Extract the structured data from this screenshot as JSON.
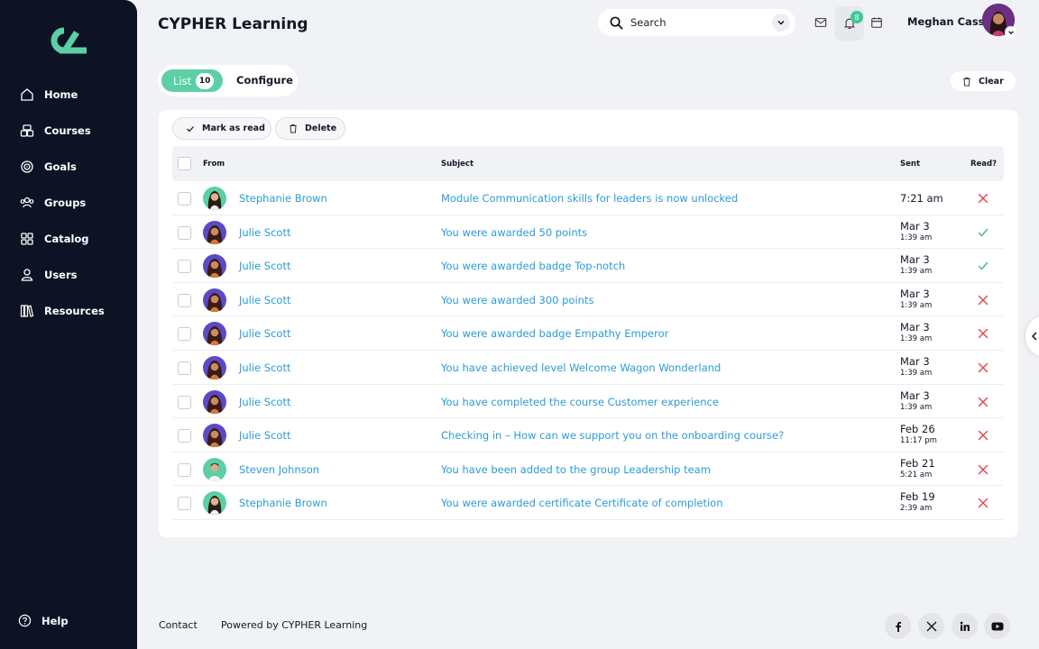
{
  "app": {
    "title": "CYPHER Learning"
  },
  "sidebar": {
    "items": [
      {
        "label": "Home",
        "icon": "home-icon"
      },
      {
        "label": "Courses",
        "icon": "courses-icon"
      },
      {
        "label": "Goals",
        "icon": "goals-icon"
      },
      {
        "label": "Groups",
        "icon": "groups-icon"
      },
      {
        "label": "Catalog",
        "icon": "catalog-icon"
      },
      {
        "label": "Users",
        "icon": "users-icon"
      },
      {
        "label": "Resources",
        "icon": "resources-icon"
      }
    ],
    "help_label": "Help"
  },
  "header": {
    "search_placeholder": "Search",
    "notification_count": "8",
    "user_name": "Meghan Cass"
  },
  "tabs": {
    "list_label": "List",
    "list_count": "10",
    "configure_label": "Configure"
  },
  "toolbar": {
    "clear_label": "Clear",
    "mark_read_label": "Mark as read",
    "delete_label": "Delete"
  },
  "table": {
    "headers": {
      "from": "From",
      "subject": "Subject",
      "sent": "Sent",
      "read": "Read?"
    },
    "rows": [
      {
        "from": "Stephanie Brown",
        "subject": "Module Communication skills for leaders is now unlocked",
        "date": "7:21 am",
        "time": "",
        "read": false,
        "avatar": "stephanie"
      },
      {
        "from": "Julie Scott",
        "subject": "You were awarded 50 points",
        "date": "Mar 3",
        "time": "1:39 am",
        "read": true,
        "avatar": "julie"
      },
      {
        "from": "Julie Scott",
        "subject": "You were awarded badge Top-notch",
        "date": "Mar 3",
        "time": "1:39 am",
        "read": true,
        "avatar": "julie"
      },
      {
        "from": "Julie Scott",
        "subject": "You were awarded 300 points",
        "date": "Mar 3",
        "time": "1:39 am",
        "read": false,
        "avatar": "julie"
      },
      {
        "from": "Julie Scott",
        "subject": "You were awarded badge Empathy Emperor",
        "date": "Mar 3",
        "time": "1:39 am",
        "read": false,
        "avatar": "julie"
      },
      {
        "from": "Julie Scott",
        "subject": "You have achieved level Welcome Wagon Wonderland",
        "date": "Mar 3",
        "time": "1:39 am",
        "read": false,
        "avatar": "julie"
      },
      {
        "from": "Julie Scott",
        "subject": "You have completed the course Customer experience",
        "date": "Mar 3",
        "time": "1:39 am",
        "read": false,
        "avatar": "julie"
      },
      {
        "from": "Julie Scott",
        "subject": "Checking in – How can we support you on the onboarding course?",
        "date": "Feb 26",
        "time": "11:17 pm",
        "read": false,
        "avatar": "julie"
      },
      {
        "from": "Steven Johnson",
        "subject": "You have been added to the group Leadership team",
        "date": "Feb 21",
        "time": "5:21 am",
        "read": false,
        "avatar": "steven"
      },
      {
        "from": "Stephanie Brown",
        "subject": "You were awarded certificate Certificate of completion",
        "date": "Feb 19",
        "time": "2:39 am",
        "read": false,
        "avatar": "stephanie"
      }
    ]
  },
  "footer": {
    "contact_label": "Contact",
    "powered_label": "Powered by CYPHER Learning",
    "social": [
      "facebook-icon",
      "x-icon",
      "linkedin-icon",
      "youtube-icon"
    ]
  },
  "colors": {
    "sidebar_bg": "#0d1325",
    "accent": "#5ccfa5",
    "link": "#2c9bd6",
    "unread_x": "#e0454f",
    "read_check": "#3dbb8a"
  }
}
